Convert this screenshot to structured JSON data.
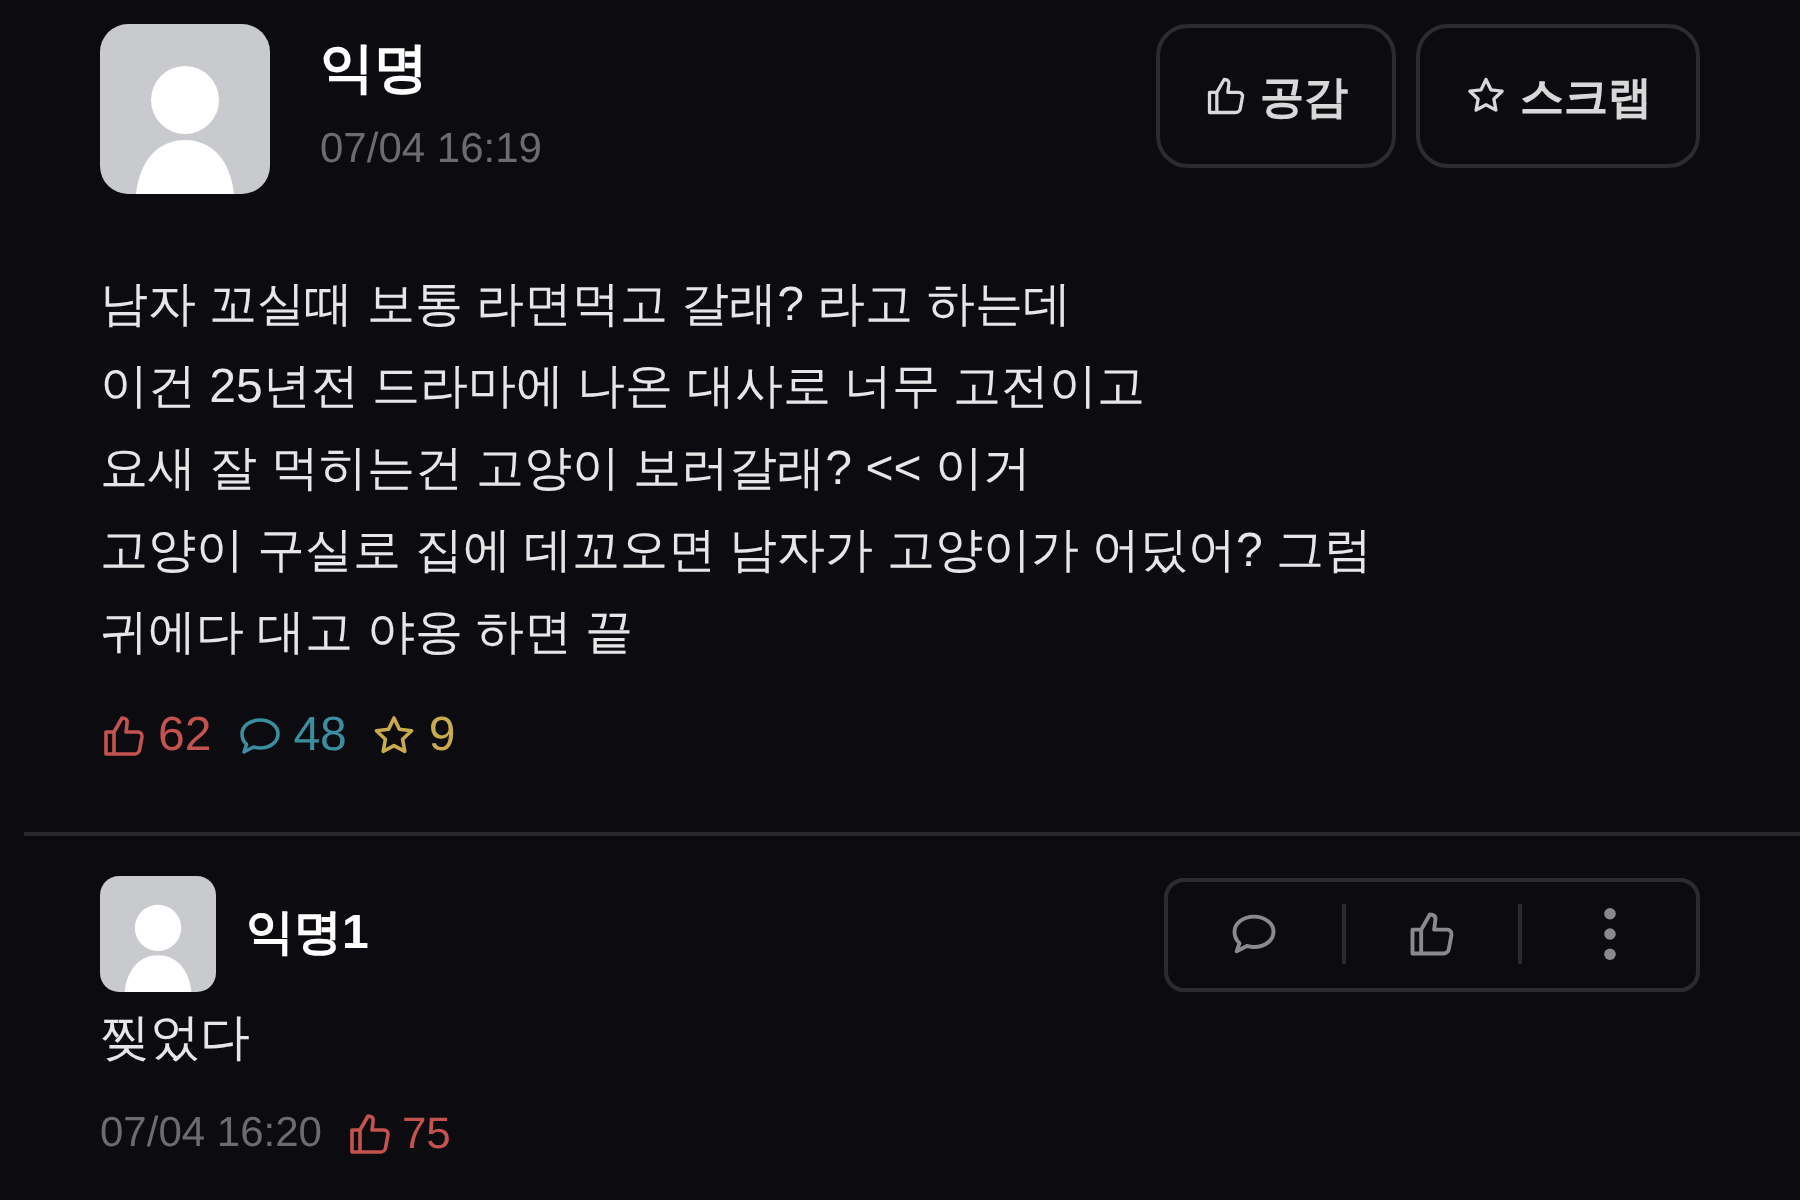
{
  "post": {
    "author": "익명",
    "time": "07/04 16:19",
    "actions": [
      {
        "kind": "like",
        "label": "공감"
      },
      {
        "kind": "scrap",
        "label": "스크랩"
      }
    ],
    "lines": [
      "남자 꼬실때 보통 라면먹고 갈래? 라고 하는데",
      "이건 25년전 드라마에 나온 대사로 너무 고전이고",
      "요새 잘 먹히는건 고양이 보러갈래? << 이거",
      "고양이 구실로 집에 데꼬오면 남자가 고양이가 어딨어? 그럼",
      "귀에다 대고 야옹 하면 끝"
    ],
    "counts": [
      {
        "kind": "like",
        "value": "62"
      },
      {
        "kind": "comment",
        "value": "48"
      },
      {
        "kind": "scrap",
        "value": "9"
      }
    ]
  },
  "comments": [
    {
      "author": "익명1",
      "text": "찢었다",
      "time": "07/04 16:20",
      "likes": "75"
    }
  ]
}
